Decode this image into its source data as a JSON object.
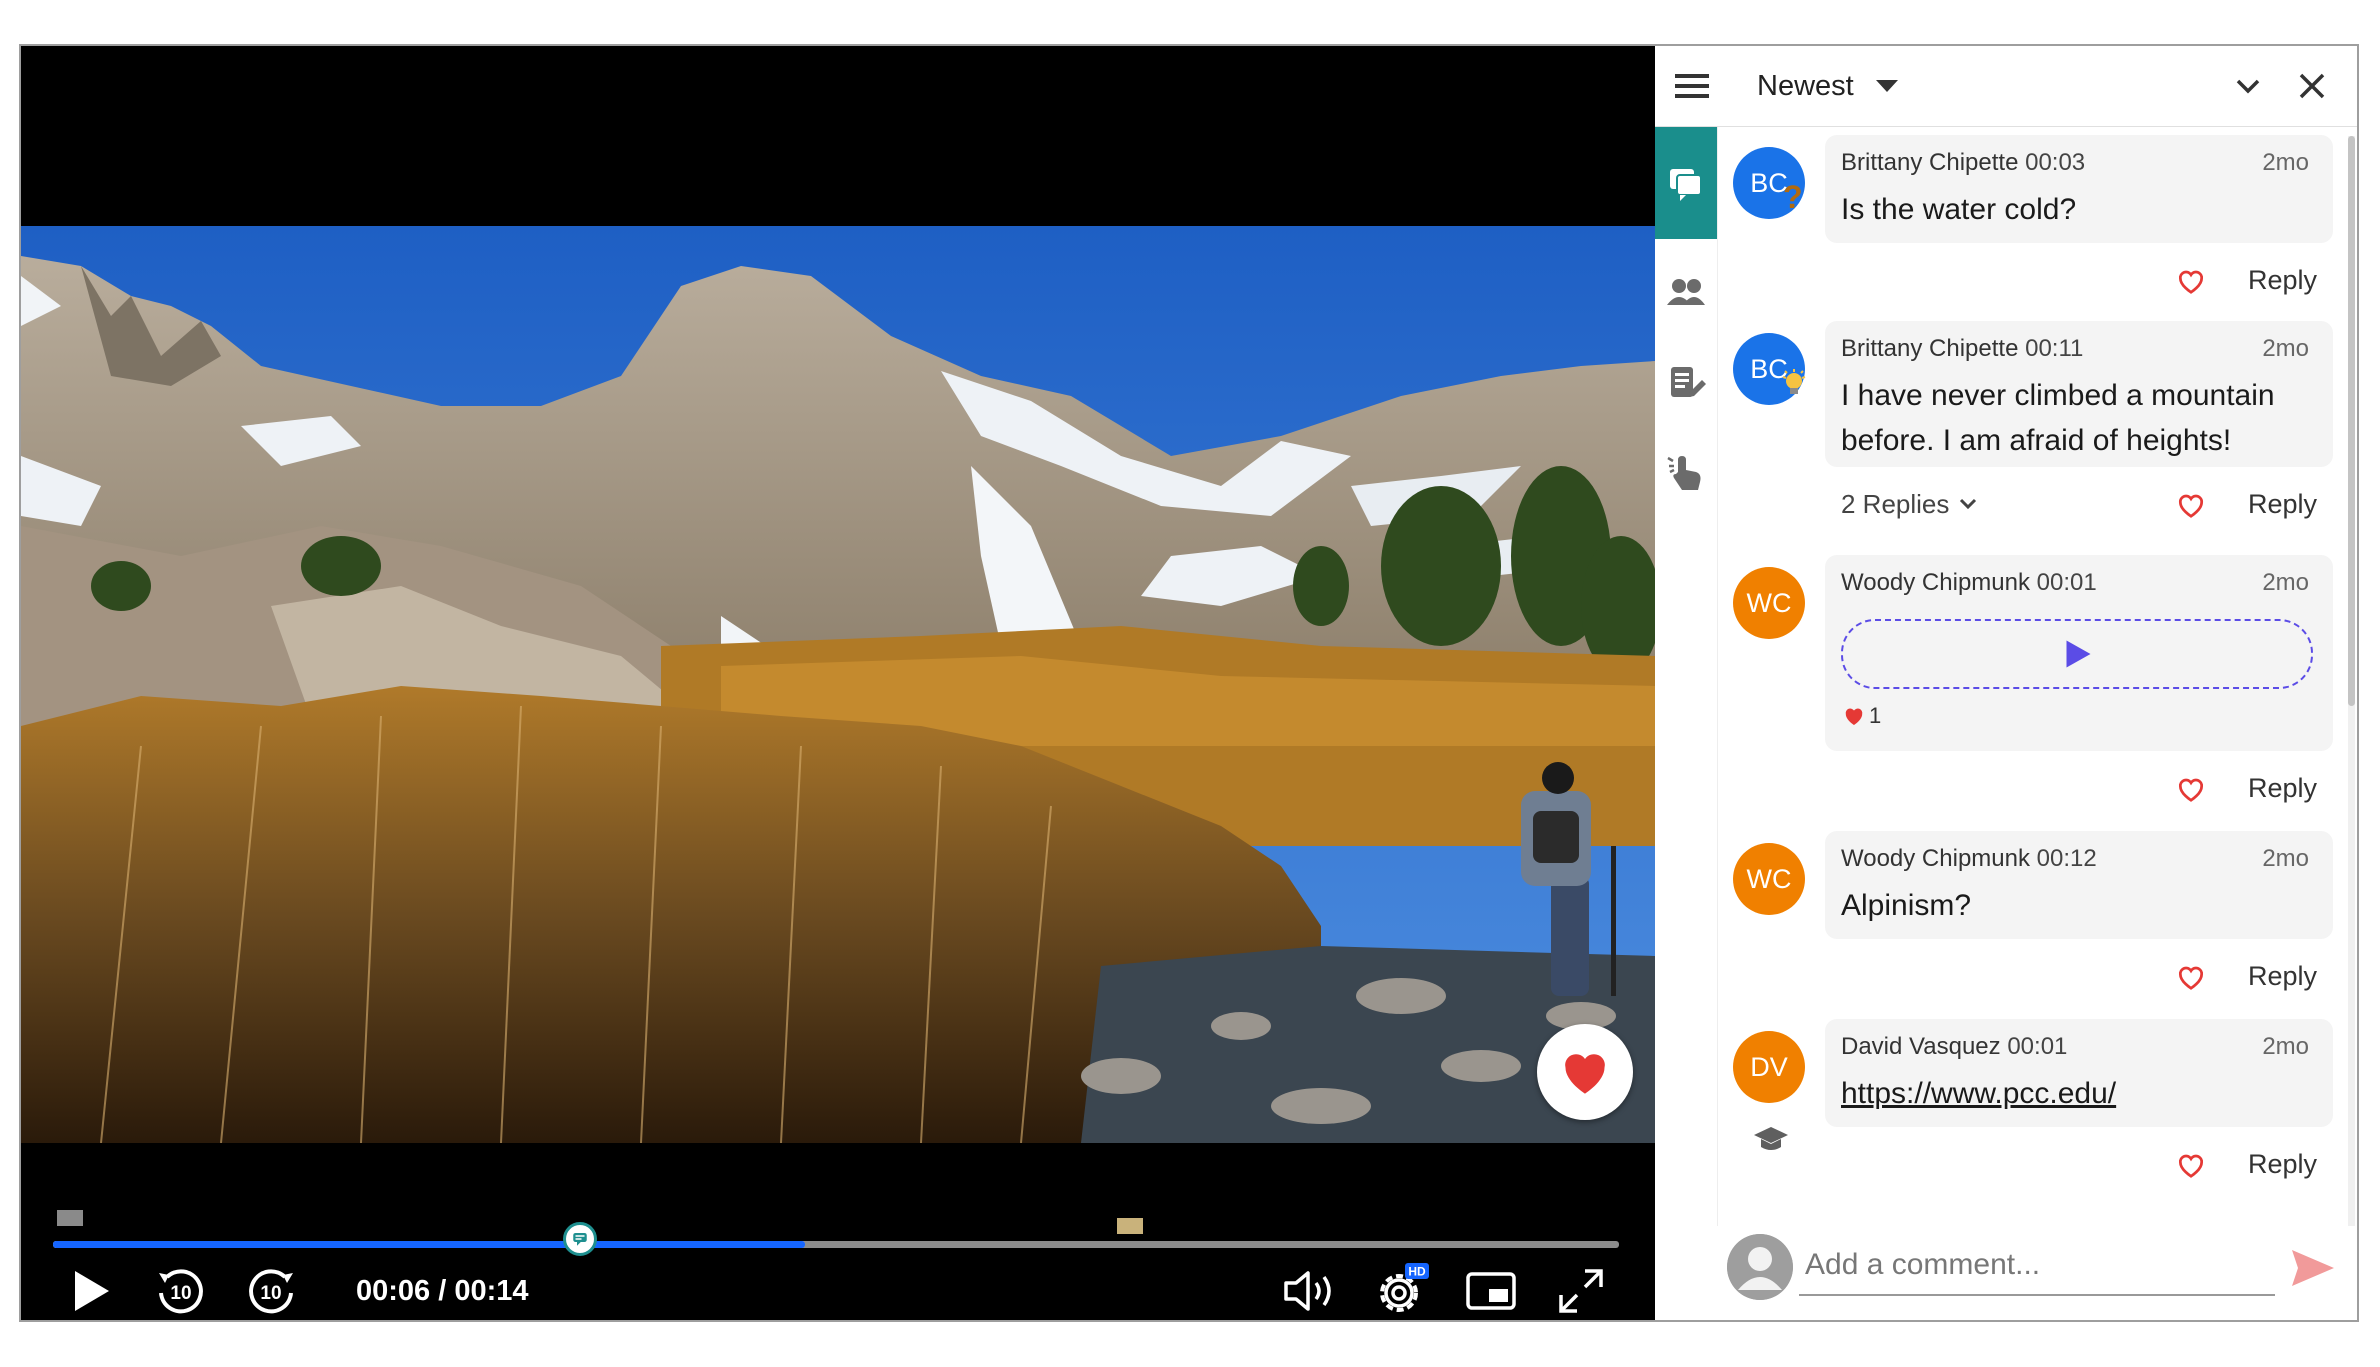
{
  "player": {
    "current_time": "00:06",
    "separator": "/",
    "duration": "00:14",
    "progress_fraction": 0.48,
    "buffered_fraction": 0.48,
    "hd_badge": "HD",
    "icons": [
      "play-icon",
      "rewind-10-icon",
      "forward-10-icon",
      "volume-icon",
      "settings-icon",
      "picture-in-picture-icon",
      "fullscreen-icon",
      "heart-icon"
    ],
    "skip_back_label": "10",
    "skip_forward_label": "10"
  },
  "panel": {
    "sort_label": "Newest",
    "rail_icons": [
      "comments-icon",
      "people-icon",
      "notes-icon",
      "interactions-icon"
    ]
  },
  "comments": [
    {
      "initials": "BC",
      "author": "Brittany Chipette",
      "ts": "00:03",
      "ago": "2mo",
      "text": "Is the water cold?",
      "avatar_color": "#1a73e8",
      "badge": "?",
      "reply_label": "Reply"
    },
    {
      "initials": "BC",
      "author": "Brittany Chipette",
      "ts": "00:11",
      "ago": "2mo",
      "text": "I have never climbed a mountain before. I am afraid of heights!",
      "avatar_color": "#1a73e8",
      "badge": "bulb",
      "replies_label": "2 Replies",
      "reply_label": "Reply"
    },
    {
      "initials": "WC",
      "author": "Woody Chipmunk",
      "ts": "00:01",
      "ago": "2mo",
      "likes": "1",
      "avatar_color": "#f08000",
      "reply_label": "Reply"
    },
    {
      "initials": "WC",
      "author": "Woody Chipmunk",
      "ts": "00:12",
      "ago": "2mo",
      "text": "Alpinism?",
      "avatar_color": "#f08000",
      "reply_label": "Reply"
    },
    {
      "initials": "DV",
      "author": "David Vasquez",
      "ts": "00:01",
      "ago": "2mo",
      "text": "https://www.pcc.edu/",
      "avatar_color": "#f08000",
      "badge": "graduation-cap",
      "reply_label": "Reply"
    }
  ],
  "composer": {
    "placeholder": "Add a comment..."
  }
}
